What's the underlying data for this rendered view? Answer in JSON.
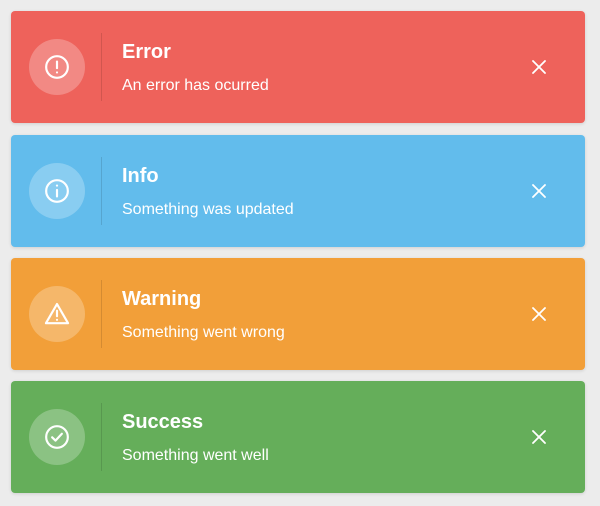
{
  "toasts": {
    "error": {
      "title": "Error",
      "message": "An error has ocurred",
      "icon": "alert-circle-icon",
      "color": "#ee625b"
    },
    "info": {
      "title": "Info",
      "message": "Something was updated",
      "icon": "info-circle-icon",
      "color": "#62bcec"
    },
    "warning": {
      "title": "Warning",
      "message": "Something went wrong",
      "icon": "warning-triangle-icon",
      "color": "#f29f39"
    },
    "success": {
      "title": "Success",
      "message": "Something went well",
      "icon": "check-circle-icon",
      "color": "#65ae5a"
    }
  }
}
